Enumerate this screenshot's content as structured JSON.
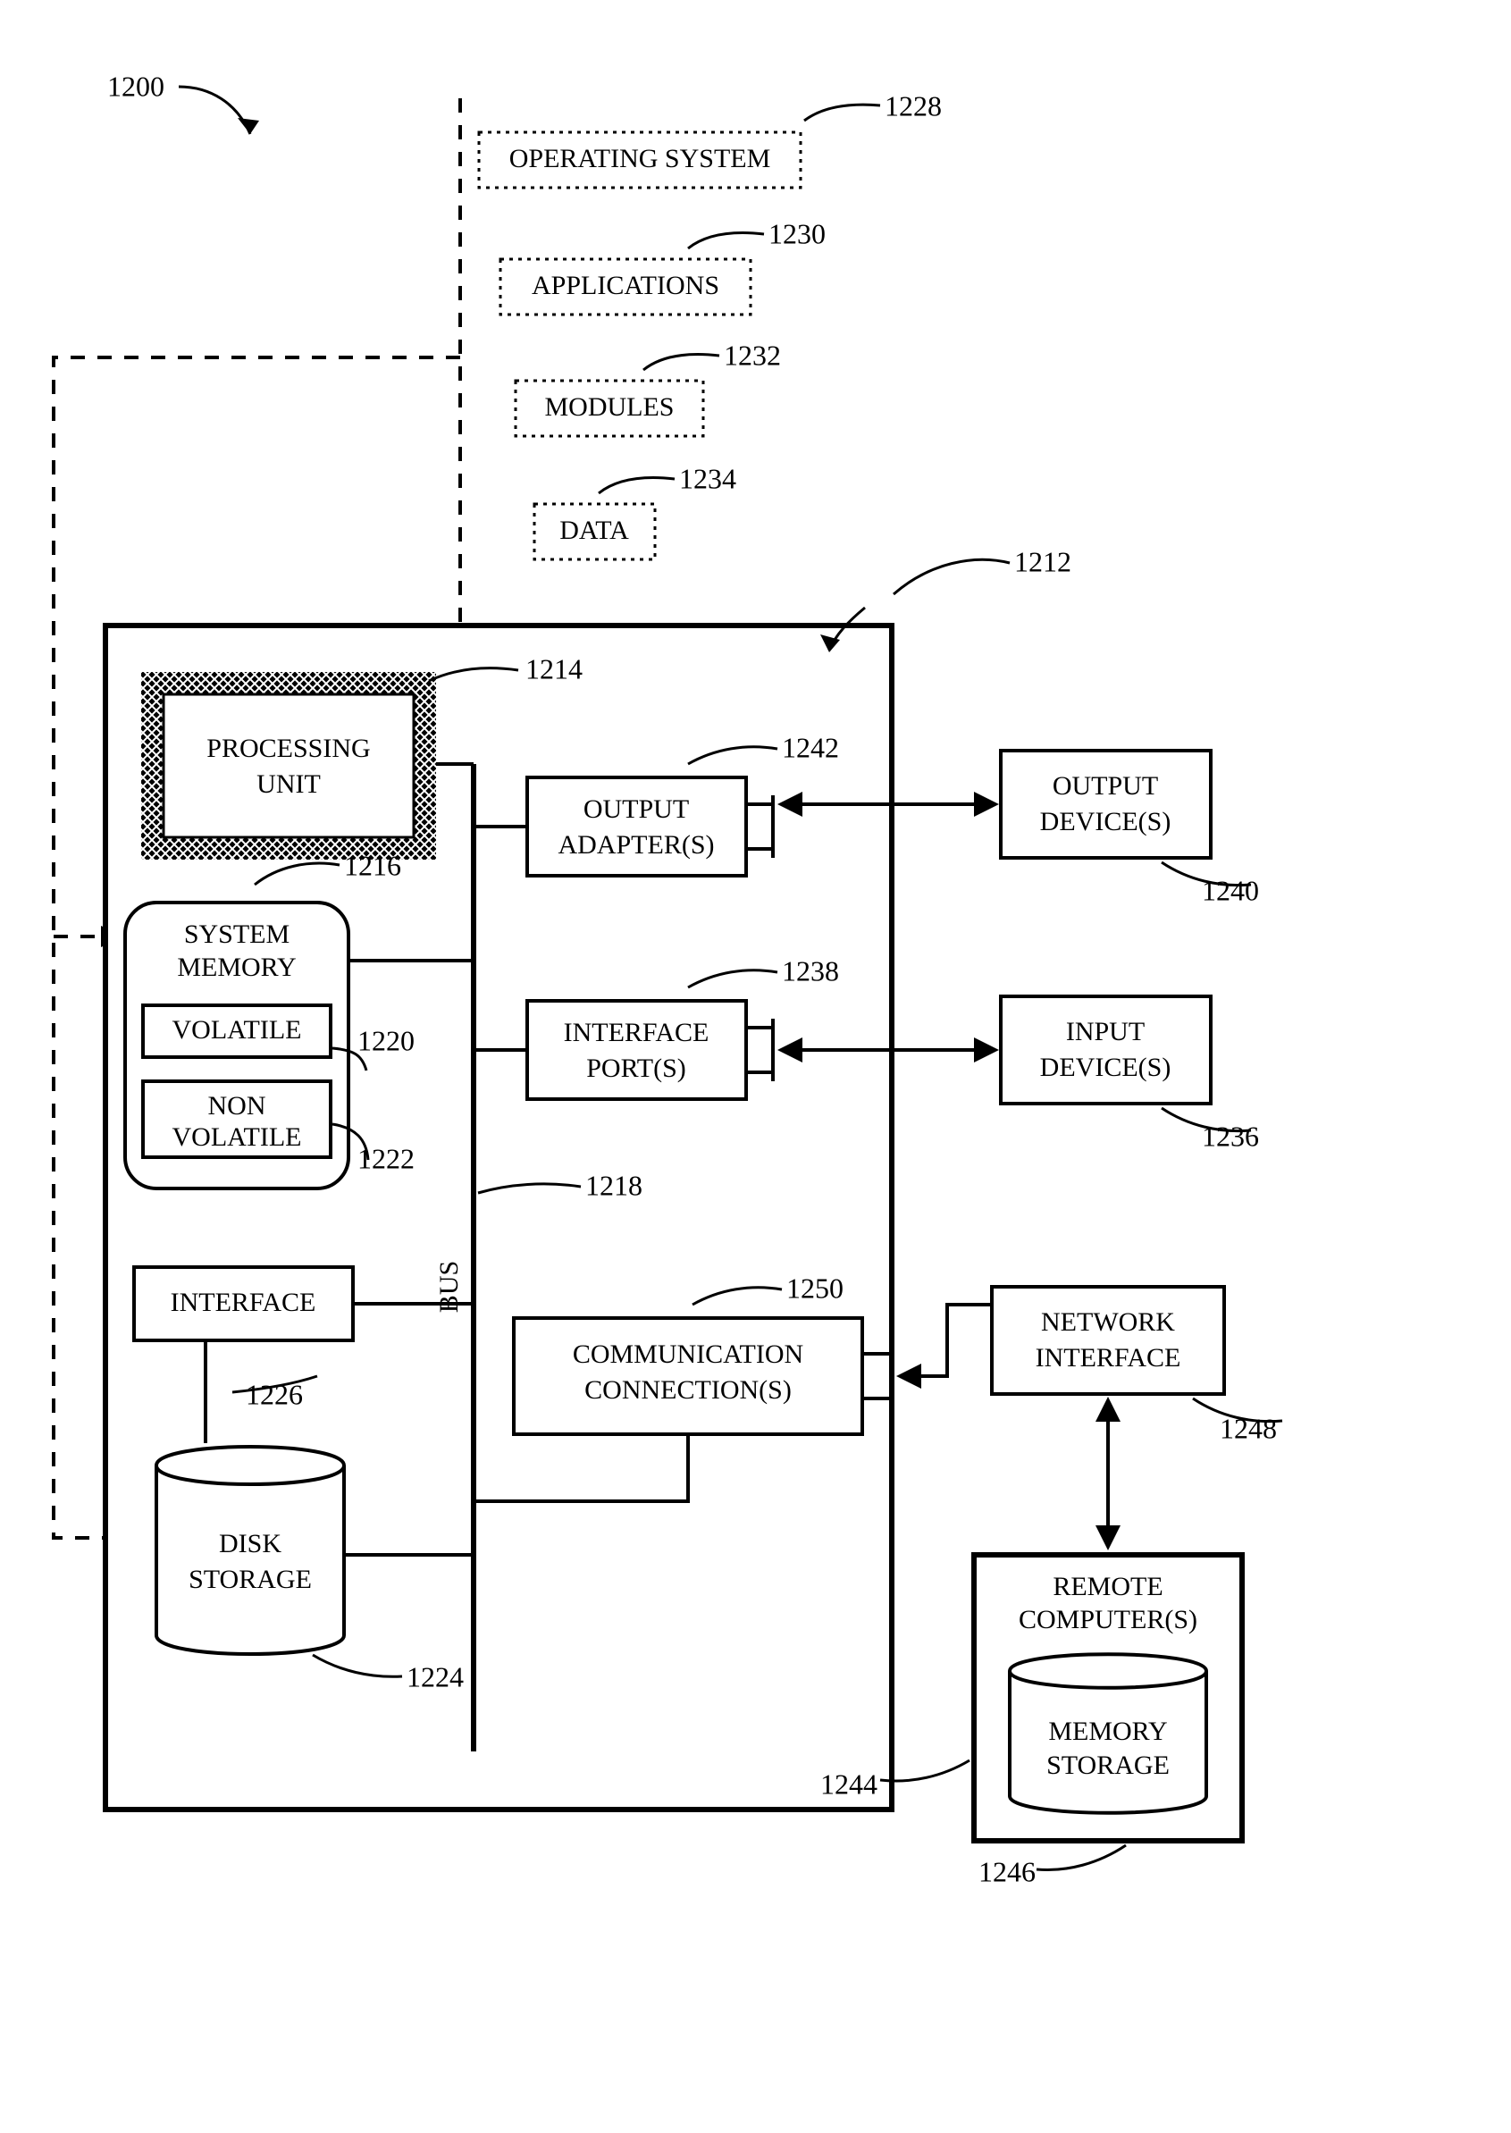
{
  "figure_ref": "1200",
  "software": {
    "os": {
      "label": "OPERATING SYSTEM",
      "ref": "1228"
    },
    "apps": {
      "label": "APPLICATIONS",
      "ref": "1230"
    },
    "modules": {
      "label": "MODULES",
      "ref": "1232"
    },
    "data": {
      "label": "DATA",
      "ref": "1234"
    }
  },
  "computer": {
    "ref": "1212",
    "processing_unit": {
      "label1": "PROCESSING",
      "label2": "UNIT",
      "ref": "1214"
    },
    "system_memory": {
      "label1": "SYSTEM",
      "label2": "MEMORY",
      "ref": "1216",
      "volatile": {
        "label": "VOLATILE",
        "ref": "1220"
      },
      "nonvolatile": {
        "label1": "NON",
        "label2": "VOLATILE",
        "ref": "1222"
      }
    },
    "bus": {
      "label": "BUS",
      "ref": "1218"
    },
    "interface": {
      "label": "INTERFACE",
      "ref": "1226"
    },
    "disk_storage": {
      "label1": "DISK",
      "label2": "STORAGE",
      "ref": "1224"
    },
    "output_adapter": {
      "label1": "OUTPUT",
      "label2": "ADAPTER(S)",
      "ref": "1242"
    },
    "interface_port": {
      "label1": "INTERFACE",
      "label2": "PORT(S)",
      "ref": "1238"
    },
    "comm_connection": {
      "label1": "COMMUNICATION",
      "label2": "CONNECTION(S)",
      "ref": "1250"
    }
  },
  "external": {
    "output_device": {
      "label1": "OUTPUT",
      "label2": "DEVICE(S)",
      "ref": "1240"
    },
    "input_device": {
      "label1": "INPUT",
      "label2": "DEVICE(S)",
      "ref": "1236"
    },
    "network_iface": {
      "label1": "NETWORK",
      "label2": "INTERFACE",
      "ref": "1248"
    },
    "remote_computer": {
      "label1": "REMOTE",
      "label2": "COMPUTER(S)",
      "ref": "1244",
      "memory_storage": {
        "label1": "MEMORY",
        "label2": "STORAGE",
        "ref": "1246"
      }
    }
  }
}
